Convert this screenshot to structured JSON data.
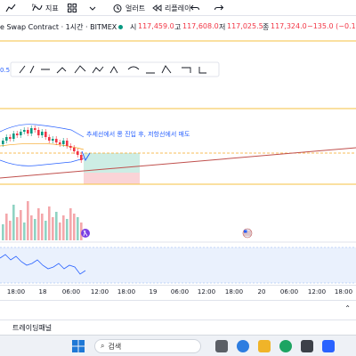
{
  "toolbar": {
    "indicators_label": "지표",
    "alerts_label": "얼러트",
    "replay_label": "리플레이"
  },
  "symbol": {
    "name": "e Swap Contract · 1시간 · BITMEX",
    "open_label": "시",
    "open_value": "117,459.0",
    "high_label": "고",
    "high_value": "117,608.0",
    "low_label": "저",
    "low_value": "117,025.5",
    "close_label": "종",
    "close_value": "117,324.0",
    "change": "−135.0 (−0.11%)",
    "up_color": "#089981",
    "down_color": "#f23645"
  },
  "chart": {
    "left_edge_value": "0.5",
    "annotation": "추세선에서 롱 진입 후, 저항선에서 매도"
  },
  "time_axis": [
    "18:00",
    "18",
    "06:00",
    "12:00",
    "18:00",
    "19",
    "06:00",
    "12:00",
    "18:00",
    "20",
    "06:00",
    "12:00",
    "18:00"
  ],
  "bottom_panel": {
    "trading_panel_label": "트레이딩패널"
  },
  "taskbar": {
    "search_placeholder": "검색"
  }
}
